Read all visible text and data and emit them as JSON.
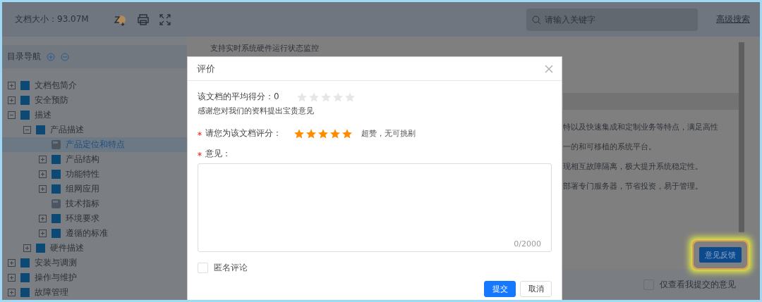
{
  "toolbar": {
    "doc_size": "文档大小：93.07M",
    "search": {
      "placeholder": "请输入关键字"
    },
    "advanced_search": "高级搜索"
  },
  "sidebar": {
    "title": "目录导航",
    "tree": [
      {
        "label": "文档包简介",
        "kind": "book",
        "expanded": false,
        "selected": false
      },
      {
        "label": "安全预防",
        "kind": "book",
        "expanded": false,
        "selected": false
      },
      {
        "label": "描述",
        "kind": "book",
        "expanded": true,
        "selected": false,
        "children": [
          {
            "label": "产品描述",
            "kind": "book",
            "expanded": true,
            "selected": false,
            "children": [
              {
                "label": "产品定位和特点",
                "kind": "page",
                "selected": true
              },
              {
                "label": "产品结构",
                "kind": "book",
                "expanded": false,
                "selected": false
              },
              {
                "label": "功能特性",
                "kind": "book",
                "expanded": false,
                "selected": false
              },
              {
                "label": "组网应用",
                "kind": "book",
                "expanded": false,
                "selected": false
              },
              {
                "label": "技术指标",
                "kind": "page",
                "selected": false
              },
              {
                "label": "环境要求",
                "kind": "book",
                "expanded": false,
                "selected": false
              },
              {
                "label": "遵循的标准",
                "kind": "book",
                "expanded": false,
                "selected": false
              }
            ]
          },
          {
            "label": "硬件描述",
            "kind": "book",
            "expanded": false,
            "selected": false
          }
        ]
      },
      {
        "label": "安装与调测",
        "kind": "book",
        "expanded": false,
        "selected": false
      },
      {
        "label": "操作与维护",
        "kind": "book",
        "expanded": false,
        "selected": false
      },
      {
        "label": "故障管理",
        "kind": "book",
        "expanded": false,
        "selected": false
      }
    ]
  },
  "content": {
    "top_line": "支持实时系统硬件运行状态监控",
    "lines": [
      "特以及快速集成和定制业务等特点，满足高性",
      "一的和可移植的系统平台。",
      "现相互故障隔离，极大提升系统稳定性。",
      "部署专门服务器，节省投资，易于管理。"
    ],
    "feedback_button": "意见反馈",
    "only_mine": {
      "label": "仅查看我提交的意见",
      "checked": false
    }
  },
  "dialog": {
    "title": "评价",
    "average": {
      "label": "该文档的平均得分：0",
      "stars": 0
    },
    "thanks": "感谢您对我们的资料提出宝贵意见",
    "rating": {
      "label": "请您为该文档评分：",
      "required": true,
      "stars": 5,
      "caption": "超赞，无可挑剔"
    },
    "comment": {
      "label": "意见：",
      "required": true,
      "counter": "0/2000"
    },
    "anonymous": {
      "label": "匿名评论",
      "checked": false
    },
    "buttons": [
      {
        "label": "提交",
        "kind": "primary"
      },
      {
        "label": "取消",
        "kind": "default"
      }
    ]
  }
}
